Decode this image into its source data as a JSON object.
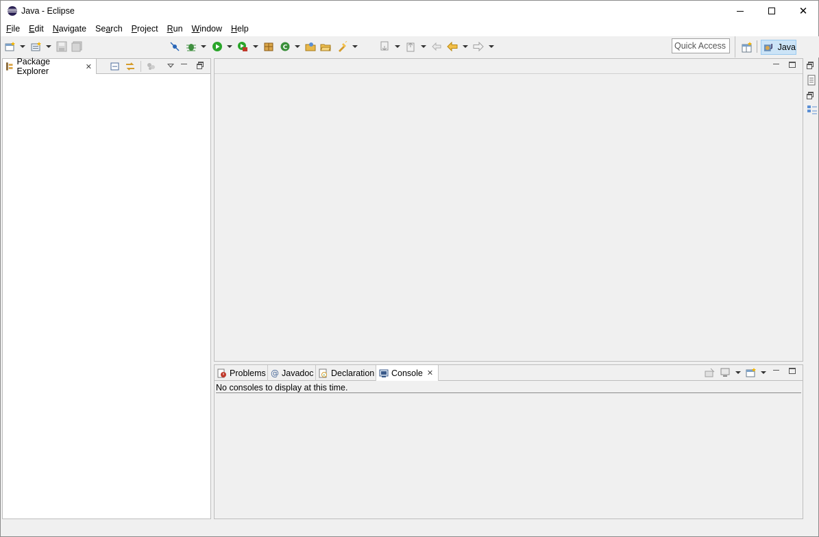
{
  "window": {
    "title": "Java - Eclipse",
    "close_glyph": "✕"
  },
  "menu": {
    "items": [
      {
        "prefix": "",
        "ul": "F",
        "rest": "ile"
      },
      {
        "prefix": "",
        "ul": "E",
        "rest": "dit"
      },
      {
        "prefix": "",
        "ul": "N",
        "rest": "avigate"
      },
      {
        "prefix": "Se",
        "ul": "a",
        "rest": "rch"
      },
      {
        "prefix": "",
        "ul": "P",
        "rest": "roject"
      },
      {
        "prefix": "",
        "ul": "R",
        "rest": "un"
      },
      {
        "prefix": "",
        "ul": "W",
        "rest": "indow"
      },
      {
        "prefix": "",
        "ul": "H",
        "rest": "elp"
      }
    ]
  },
  "toolbar": {
    "quick_access_placeholder": "Quick Access",
    "perspective_label": "Java"
  },
  "package_explorer": {
    "tab_label": "Package Explorer",
    "close_glyph": "✕"
  },
  "bottom_panel": {
    "tabs": [
      {
        "label": "Problems"
      },
      {
        "label": "Javadoc"
      },
      {
        "label": "Declaration"
      },
      {
        "label": "Console"
      }
    ],
    "close_glyph": "✕",
    "console_message": "No consoles to display at this time."
  },
  "colors": {
    "accent_selection": "#cce4f7",
    "run_green": "#2aa52a",
    "debug_green": "#3f8f3f",
    "eclipse_purple": "#2c2255"
  }
}
